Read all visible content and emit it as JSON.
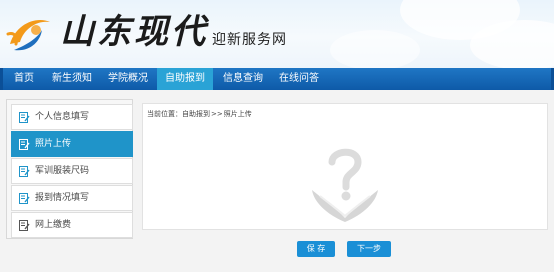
{
  "header": {
    "school_name": "山东现代",
    "site_title": "迎新服务网"
  },
  "nav": {
    "items": [
      {
        "label": "首页"
      },
      {
        "label": "新生须知"
      },
      {
        "label": "学院概况"
      },
      {
        "label": "自助报到",
        "active": true
      },
      {
        "label": "信息查询"
      },
      {
        "label": "在线问答"
      }
    ]
  },
  "sidebar": {
    "items": [
      {
        "label": "个人信息填写"
      },
      {
        "label": "照片上传",
        "active": true
      },
      {
        "label": "军训服装尺码"
      },
      {
        "label": "报到情况填写"
      },
      {
        "label": "网上缴费"
      }
    ]
  },
  "breadcrumb": {
    "prefix": "当前位置：",
    "parent": "自助报到",
    "separator": ">>",
    "current": "照片上传"
  },
  "buttons": {
    "save": "保 存",
    "next": "下一步"
  },
  "icons": {
    "logo": "orange-swirl-logo-icon",
    "sidebar_item": "edit-icon",
    "placeholder": "question-mark-photo-icon"
  },
  "colors": {
    "nav": "#1565b8",
    "nav_active": "#2aa3d6",
    "sidebar_active": "#1f94c9",
    "button": "#1a8fd6",
    "logo_orange": "#f39a1a",
    "logo_blue": "#1f6fbe"
  }
}
